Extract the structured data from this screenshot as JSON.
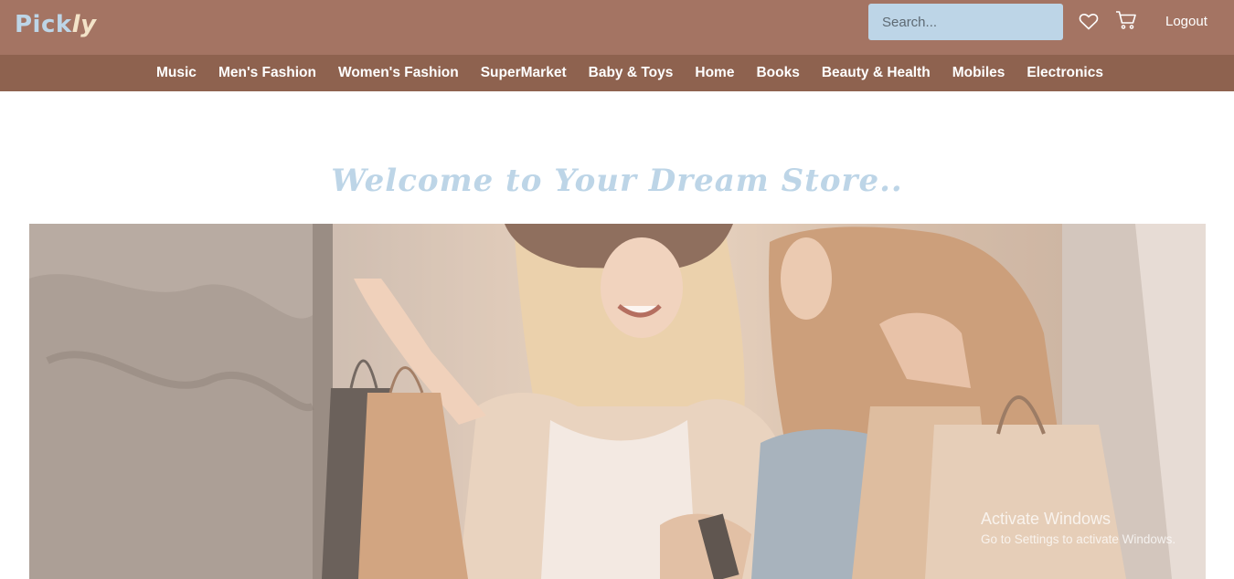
{
  "header": {
    "logo_part1": "Pick",
    "logo_part2": "ly",
    "search_placeholder": "Search...",
    "logout_label": "Logout",
    "icons": [
      "heart-icon",
      "cart-icon"
    ]
  },
  "nav": {
    "categories": [
      "Music",
      "Men's Fashion",
      "Women's Fashion",
      "SuperMarket",
      "Baby & Toys",
      "Home",
      "Books",
      "Beauty & Health",
      "Mobiles",
      "Electronics"
    ]
  },
  "main": {
    "welcome": "Welcome to Your Dream Store.."
  },
  "overlay": {
    "activate_title": "Activate Windows",
    "activate_sub": "Go to Settings to activate Windows."
  },
  "colors": {
    "header_bg": "#a47463",
    "nav_bg": "#8e624f",
    "accent_light_blue": "#bdd5e7"
  }
}
